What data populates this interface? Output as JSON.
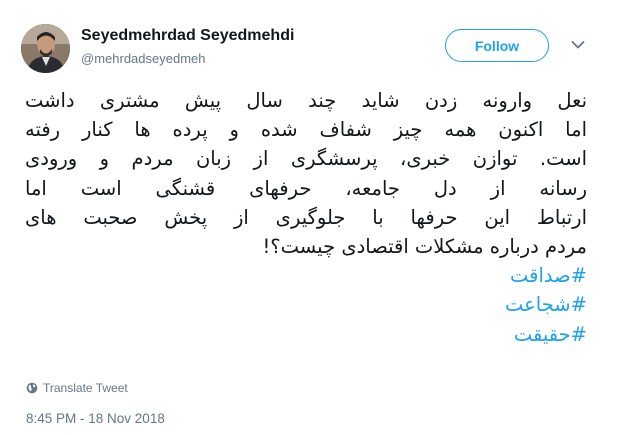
{
  "user": {
    "display_name": "Seyedmehrdad Seyedmehdi",
    "handle": "@mehrdadseyedmeh",
    "avatar": "profile-photo"
  },
  "actions": {
    "follow_label": "Follow",
    "more_icon": "chevron-down-icon"
  },
  "tweet": {
    "lines": [
      "نعل وارونه زدن شاید چند سال پیش مشتری داشت",
      "اما اکنون همه چیز شفاف شده و پرده ها کنار رفته",
      "است. توازن خبری، پرسشگری از زبان مردم و ورودی",
      "رسانه از دل جامعه، حرفهای قشنگی است اما",
      "ارتباط این حرفها با جلوگیری از پخش صحبت های",
      "مردم درباره مشکلات اقتصادی چیست؟!"
    ],
    "hashtags": [
      "#صداقت",
      "#شجاعت",
      "#حقیقت"
    ]
  },
  "footer": {
    "translate_label": "Translate Tweet",
    "timestamp": "8:45 PM - 18 Nov 2018"
  },
  "colors": {
    "accent": "#1da1f2",
    "text": "#14171a",
    "muted": "#657786"
  }
}
